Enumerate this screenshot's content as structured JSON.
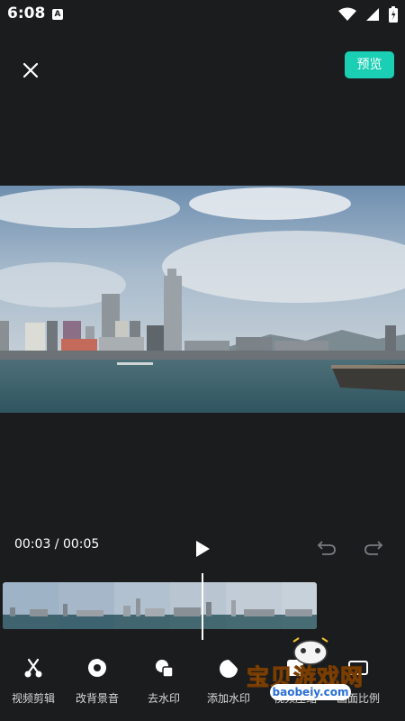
{
  "status_bar": {
    "time": "6:08",
    "notification_letter": "A"
  },
  "top_bar": {
    "preview_label": "预览"
  },
  "playback": {
    "time_readout": "00:03 / 00:05"
  },
  "toolbar": {
    "tools": [
      {
        "label": "视频剪辑",
        "icon": "scissors-icon"
      },
      {
        "label": "改背景音",
        "icon": "music-disc-icon"
      },
      {
        "label": "去水印",
        "icon": "remove-watermark-icon"
      },
      {
        "label": "添加水印",
        "icon": "add-watermark-icon"
      },
      {
        "label": "视频压缩",
        "icon": "compress-icon"
      },
      {
        "label": "画面比例",
        "icon": "aspect-ratio-icon"
      }
    ]
  },
  "watermark": {
    "title": "宝贝游戏网",
    "url": "baobeiy.com"
  },
  "colors": {
    "accent": "#1bcfb5",
    "background": "#1b1c1e"
  }
}
